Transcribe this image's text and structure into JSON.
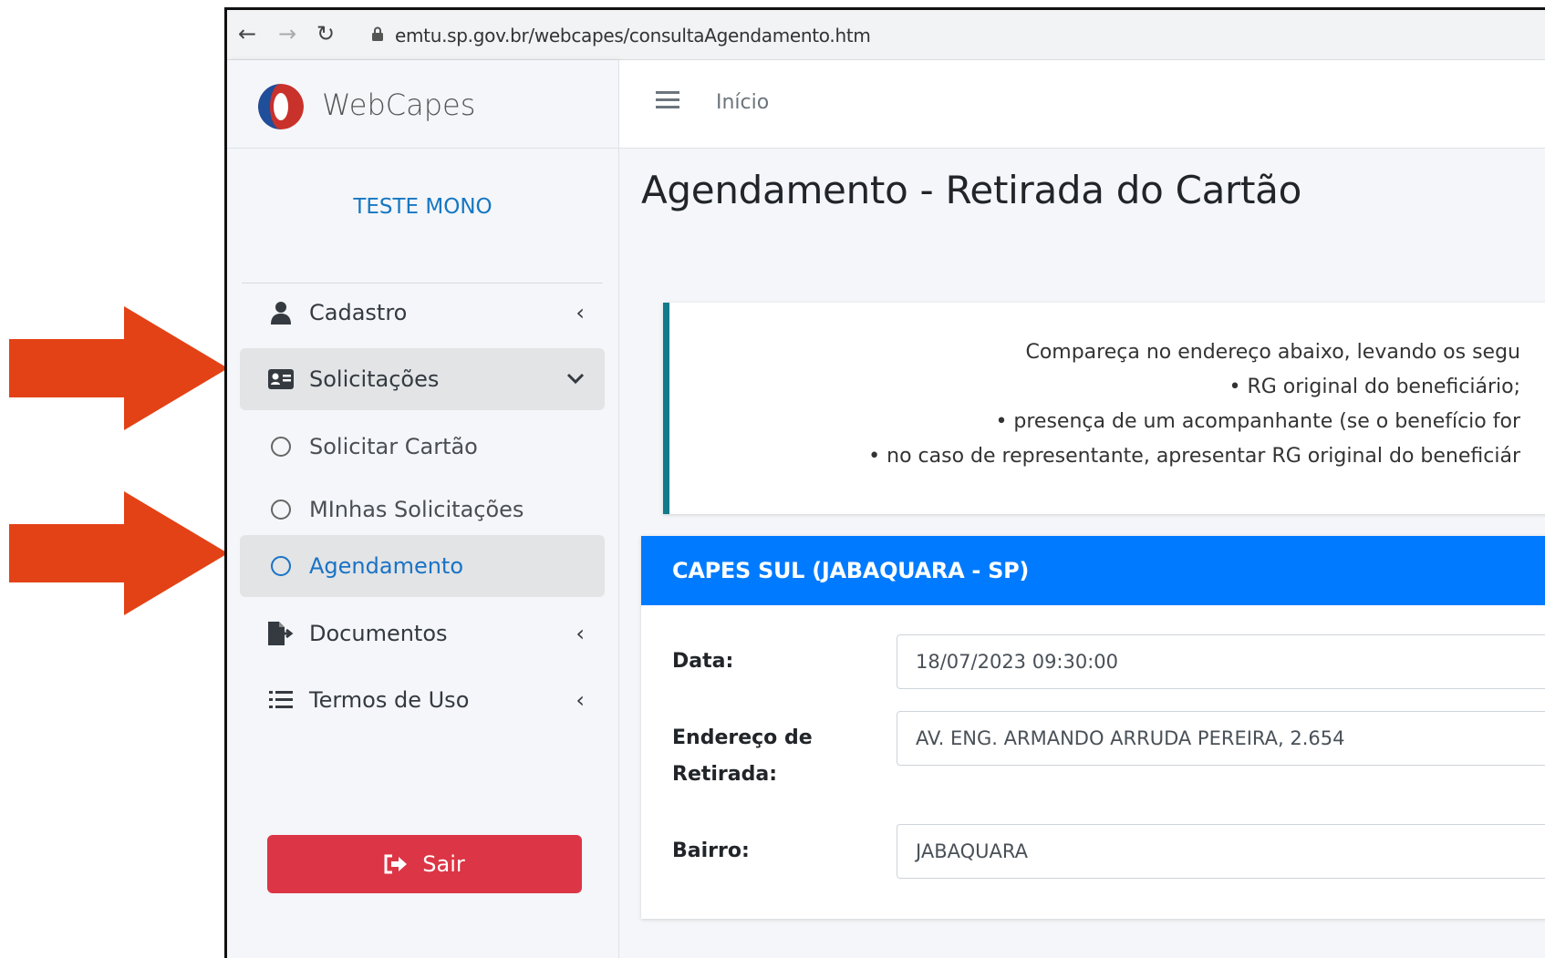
{
  "browser": {
    "url": "emtu.sp.gov.br/webcapes/consultaAgendamento.htm"
  },
  "sidebar": {
    "brand": "WebCapes",
    "user": "TESTE MONO",
    "items": [
      {
        "label": "Cadastro",
        "icon": "user-icon",
        "chevron": "chevron-left"
      },
      {
        "label": "Solicitações",
        "icon": "id-card-icon",
        "chevron": "chevron-down",
        "active": true
      },
      {
        "label": "Solicitar Cartão",
        "icon": "circle-icon"
      },
      {
        "label": "MInhas Solicitações",
        "icon": "circle-icon"
      },
      {
        "label": "Agendamento",
        "icon": "circle-icon",
        "active": true
      },
      {
        "label": "Documentos",
        "icon": "file-export-icon",
        "chevron": "chevron-left"
      },
      {
        "label": "Termos de Uso",
        "icon": "list-icon",
        "chevron": "chevron-left"
      }
    ],
    "logout": "Sair"
  },
  "topnav": {
    "home": "Início"
  },
  "page": {
    "title": "Agendamento - Retirada do Cartão"
  },
  "callout": {
    "lines": [
      "Compareça no endereço abaixo, levando os segu",
      "• RG original do beneficiário;",
      "• presença de um acompanhante (se o benefício for",
      "• no caso de representante, apresentar RG original do beneficiár"
    ]
  },
  "card": {
    "title": "CAPES SUL (JABAQUARA - SP)",
    "fields": [
      {
        "label": "Data:",
        "value": "18/07/2023 09:30:00"
      },
      {
        "label_line1": "Endereço de",
        "label_line2": "Retirada:",
        "value": "AV. ENG. ARMANDO ARRUDA PEREIRA, 2.654"
      },
      {
        "label": "Bairro:",
        "value": "JABAQUARA"
      }
    ]
  },
  "colors": {
    "arrow": "#e34216",
    "primary": "#007bff",
    "danger": "#dc3545",
    "callout_border": "#117a8b",
    "active_link": "#1a73c5"
  }
}
